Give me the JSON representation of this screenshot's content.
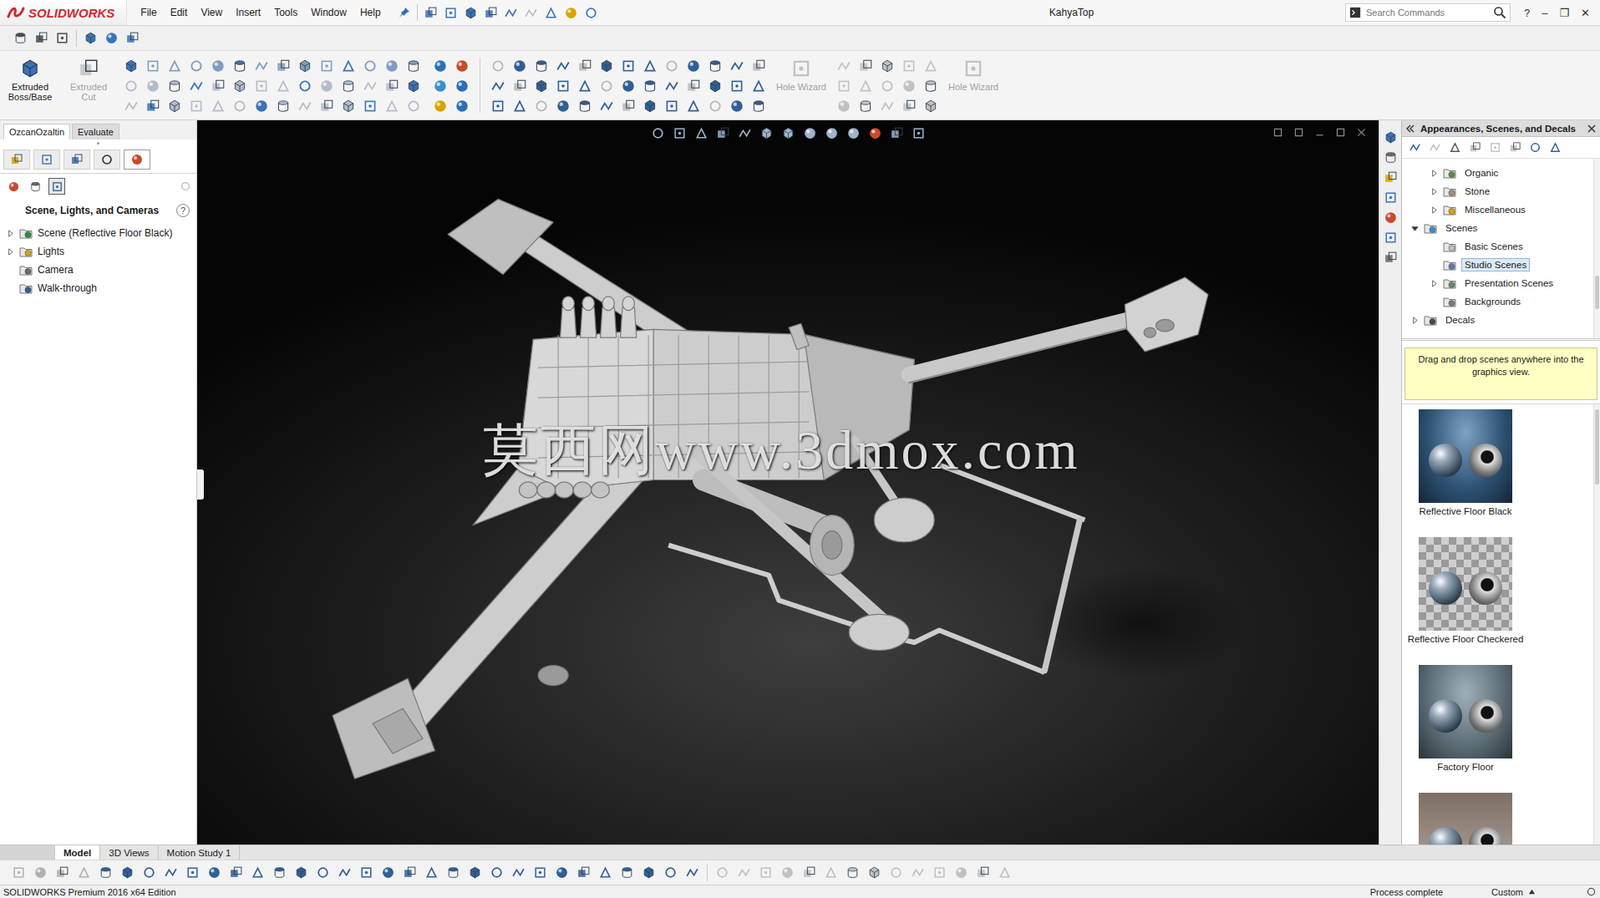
{
  "app": {
    "logo": "SOLIDWORKS",
    "title": "KahyaTop"
  },
  "menu": [
    "File",
    "Edit",
    "View",
    "Insert",
    "Tools",
    "Window",
    "Help"
  ],
  "search": {
    "placeholder": "Search Commands"
  },
  "window_controls": [
    "?",
    "–",
    "❐",
    "✕"
  ],
  "ribbon": {
    "buttons": [
      {
        "label": "Extruded Boss/Base",
        "disabled": false
      },
      {
        "label": "Extruded Cut",
        "disabled": true
      },
      {
        "label": "Hole Wizard",
        "disabled": true
      },
      {
        "label": "Hole Wizard",
        "disabled": true
      }
    ]
  },
  "command_tabs": [
    {
      "label": "OzcanOzaltin",
      "selected": true
    },
    {
      "label": "Evaluate",
      "selected": false
    }
  ],
  "left_panel": {
    "panel_tabs": [
      {
        "selected": false
      },
      {
        "selected": false
      },
      {
        "selected": false
      },
      {
        "selected": false
      },
      {
        "selected": true
      }
    ],
    "display_tabs": [
      {
        "selected": false
      },
      {
        "selected": false
      },
      {
        "selected": true
      }
    ],
    "title": "Scene, Lights, and Cameras",
    "help": "?",
    "tree": [
      {
        "label": "Scene (Reflective Floor Black)",
        "expandable": true,
        "expanded": false
      },
      {
        "label": "Lights",
        "expandable": true,
        "expanded": false
      },
      {
        "label": "Camera",
        "expandable": false,
        "expanded": false
      },
      {
        "label": "Walk-through",
        "expandable": false,
        "expanded": false
      }
    ]
  },
  "viewport": {
    "watermark": "莫西网www.3dmox.com"
  },
  "right_panel": {
    "title": "Appearances, Scenes, and Decals",
    "tree": [
      {
        "label": "Organic",
        "depth": 1,
        "expandable": true,
        "expanded": false,
        "selected": false
      },
      {
        "label": "Stone",
        "depth": 1,
        "expandable": true,
        "expanded": false,
        "selected": false
      },
      {
        "label": "Miscellaneous",
        "depth": 1,
        "expandable": true,
        "expanded": false,
        "selected": false
      },
      {
        "label": "Scenes",
        "depth": 0,
        "expandable": true,
        "expanded": true,
        "selected": false
      },
      {
        "label": "Basic Scenes",
        "depth": 1,
        "expandable": false,
        "expanded": false,
        "selected": false
      },
      {
        "label": "Studio Scenes",
        "depth": 1,
        "expandable": false,
        "expanded": false,
        "selected": true
      },
      {
        "label": "Presentation Scenes",
        "depth": 1,
        "expandable": true,
        "expanded": false,
        "selected": false
      },
      {
        "label": "Backgrounds",
        "depth": 1,
        "expandable": false,
        "expanded": false,
        "selected": false
      },
      {
        "label": "Decals",
        "depth": 0,
        "expandable": true,
        "expanded": false,
        "selected": false
      }
    ],
    "hint": "Drag and drop scenes anywhere into the graphics view.",
    "thumbnails": [
      {
        "label": "Reflective Floor Black",
        "kind": "black"
      },
      {
        "label": "Reflective Floor Checkered",
        "kind": "checkered"
      },
      {
        "label": "Factory Floor",
        "kind": "factory"
      },
      {
        "kind": "partial"
      }
    ]
  },
  "bottom_tabs": [
    {
      "label": "Model",
      "selected": true
    },
    {
      "label": "3D Views",
      "selected": false
    },
    {
      "label": "Motion Study 1",
      "selected": false
    }
  ],
  "status_bar": {
    "edition": "SOLIDWORKS Premium 2016 x64 Edition",
    "message": "Process complete",
    "units": "Custom"
  }
}
